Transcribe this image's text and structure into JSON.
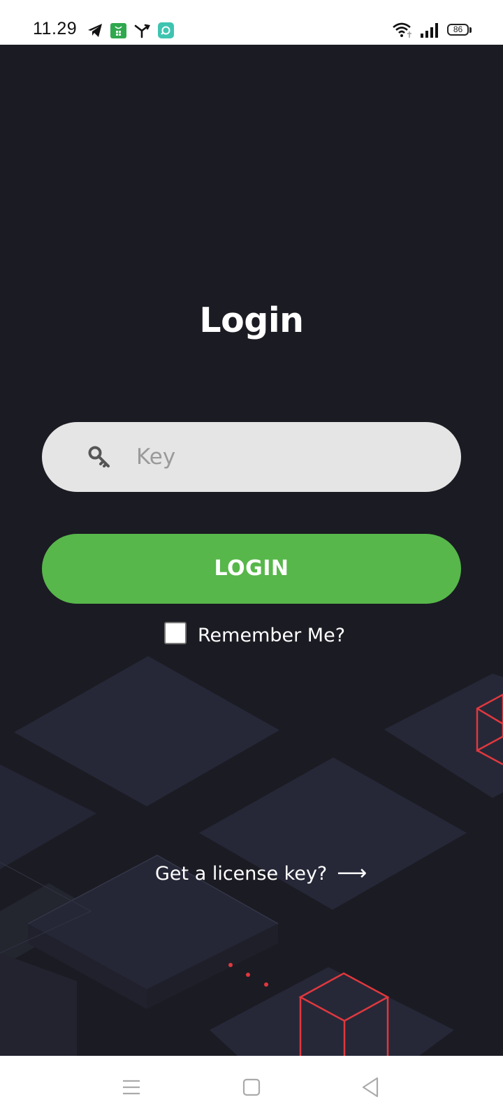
{
  "status_bar": {
    "time": "11.29",
    "notification_icons": [
      "telegram-icon",
      "store-icon",
      "merge-icon",
      "assistant-icon"
    ],
    "system_icons": [
      "wifi-icon",
      "signal-icon",
      "battery-icon"
    ],
    "battery_level": "86"
  },
  "login": {
    "title": "Login",
    "key_placeholder": "Key",
    "key_value": "",
    "key_icon": "key-icon",
    "button_label": "LOGIN",
    "remember_label": "Remember Me?",
    "remember_checked": false,
    "license_link": "Get a license key?",
    "license_arrow": "⟶"
  },
  "nav_bar": {
    "buttons": [
      "menu-icon",
      "home-icon",
      "back-icon"
    ]
  },
  "colors": {
    "background": "#1b1b23",
    "accent_green": "#57b74a",
    "input_background": "#e5e5e5",
    "decoration_red": "#e0383e"
  }
}
